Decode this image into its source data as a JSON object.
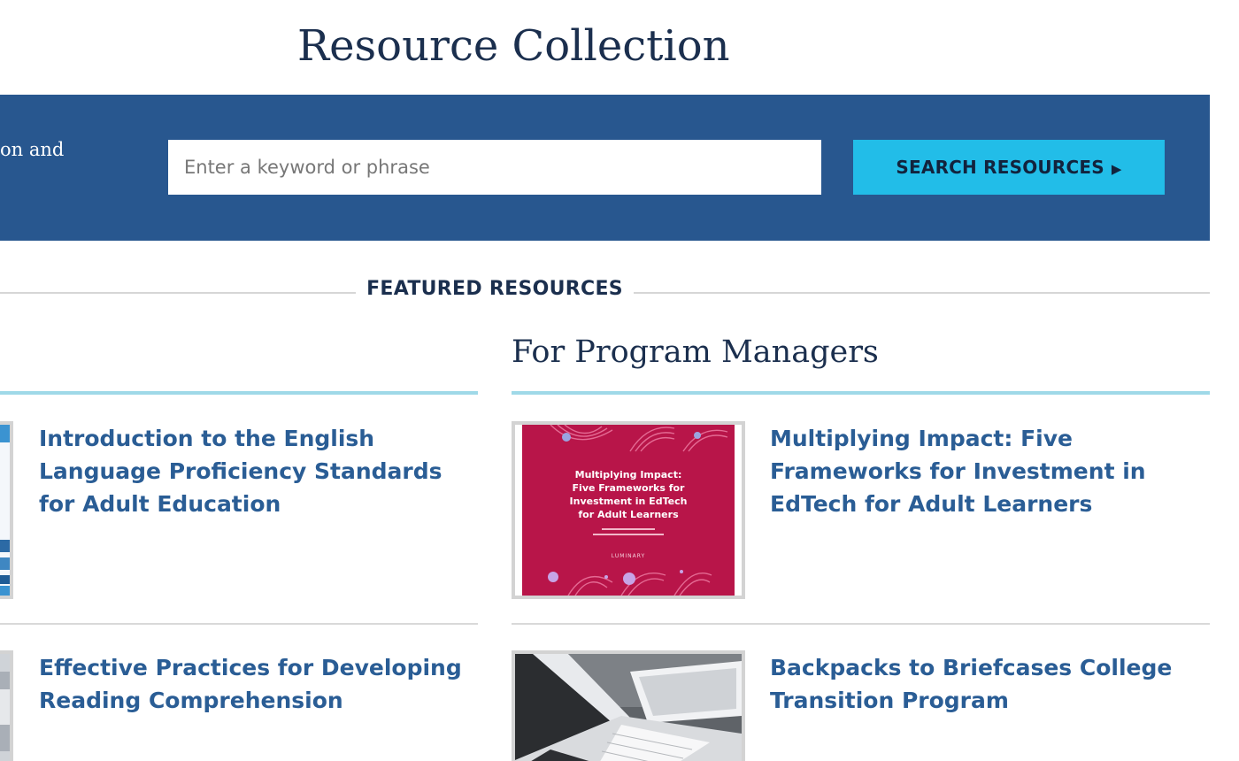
{
  "page": {
    "title": "Resource Collection"
  },
  "search": {
    "intro_text": "on and",
    "placeholder": "Enter a keyword or phrase",
    "button_label": "SEARCH RESOURCES",
    "button_arrow": "▶"
  },
  "featured": {
    "label": "FEATURED RESOURCES",
    "columns": [
      {
        "heading": "",
        "items": [
          {
            "title": "Introduction to the English Language Proficiency Standards for Adult Education",
            "thumbnail": "standards-cover-thumbnail"
          },
          {
            "title": "Effective Practices for Developing Reading Comprehension",
            "thumbnail": "reading-cover-thumbnail"
          }
        ]
      },
      {
        "heading": "For Program Managers",
        "items": [
          {
            "title": "Multiplying Impact: Five Frameworks for Investment in EdTech for Adult Learners",
            "thumbnail": "report-cover-thumbnail"
          },
          {
            "title": "Backpacks to Briefcases College Transition Program",
            "thumbnail": "laptop-photo-thumbnail"
          }
        ]
      }
    ]
  },
  "thumbnail_cover": {
    "line1": "Multiplying Impact:",
    "line2": "Five Frameworks for",
    "line3": "Investment in EdTech",
    "line4": "for Adult Learners",
    "publisher": "LUMINARY"
  },
  "colors": {
    "navy_text": "#1b2f4e",
    "band_blue": "#28578f",
    "button_cyan": "#22bde8",
    "link_blue": "#2a5d95",
    "column_rule": "#9fd9e8",
    "cover_magenta": "#b81549"
  }
}
